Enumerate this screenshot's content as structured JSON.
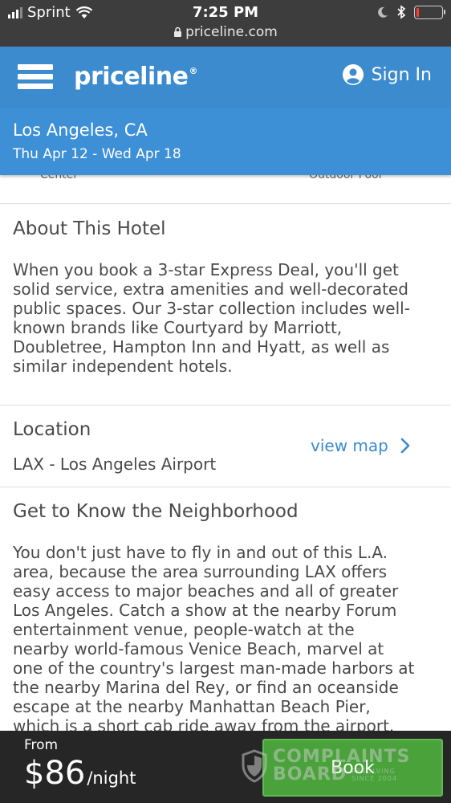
{
  "status_bar": {
    "carrier": "Sprint",
    "time": "7:25 PM",
    "url": "priceline.com",
    "battery_level": 0.1,
    "battery_color": "#ff3b30"
  },
  "app_bar": {
    "logo": "priceline",
    "logo_mark": "®",
    "sign_in": "Sign In",
    "color": "#3c8bcf"
  },
  "search": {
    "city": "Los Angeles, CA",
    "dates": "Thu Apr 12 - Wed Apr 18"
  },
  "amenities_partial": [
    "Center",
    "Outdoor Pool"
  ],
  "about": {
    "heading": "About This Hotel",
    "lines": [
      "When you book a 3-star Express Deal, you'll get",
      "solid service, extra amenities and well-decorated",
      "public spaces. Our 3-star collection includes well-",
      "known brands like Courtyard by Marriott,",
      "Doubletree, Hampton Inn and Hyatt, as well as",
      "similar independent hotels."
    ]
  },
  "location": {
    "heading": "Location",
    "name": "LAX - Los Angeles Airport",
    "view_map": "view map"
  },
  "neighborhood": {
    "heading": "Get to Know the Neighborhood",
    "lines": [
      "You don't just have to fly in and out of this L.A.",
      "area, because the area surrounding LAX offers",
      "easy access to major beaches and all of greater",
      "Los Angeles. Catch a show at the nearby Forum",
      "entertainment venue, people-watch at the",
      "nearby world-famous Venice Beach, marvel at",
      "one of the country's largest man-made harbors at",
      "the nearby Marina del Rey, or find an oceanside",
      "escape at the nearby Manhattan Beach Pier,",
      "which is a short cab ride away from the airport."
    ]
  },
  "booking": {
    "from_label": "From",
    "price": "$86",
    "unit": "/night",
    "button": "Book",
    "button_color": "#49a33a"
  },
  "watermark": {
    "line1": "COMPLAINTS",
    "line2": "BOARD",
    "sub1": "RESOLVING",
    "sub2": "SINCE 2004"
  }
}
